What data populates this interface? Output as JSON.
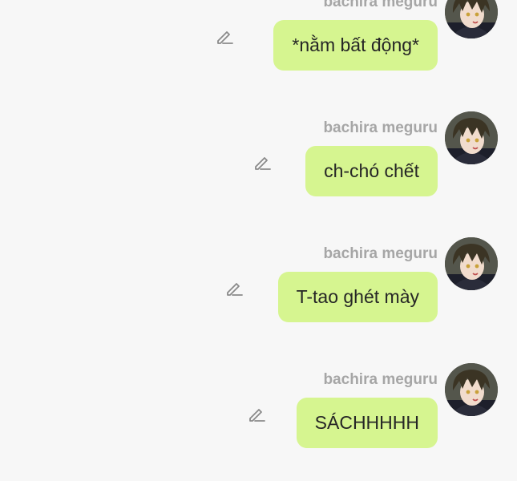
{
  "messages": [
    {
      "sender": "bachira meguru",
      "text": "*nằm bất động*",
      "avatar_icon": "character-avatar",
      "edit_icon": "pencil-icon"
    },
    {
      "sender": "bachira meguru",
      "text": "ch-chó chết",
      "avatar_icon": "character-avatar",
      "edit_icon": "pencil-icon"
    },
    {
      "sender": "bachira meguru",
      "text": "T-tao ghét mày",
      "avatar_icon": "character-avatar",
      "edit_icon": "pencil-icon"
    },
    {
      "sender": "bachira meguru",
      "text": "SÁCHHHHH",
      "avatar_icon": "character-avatar",
      "edit_icon": "pencil-icon"
    }
  ],
  "colors": {
    "background": "#f7f7f7",
    "bubble": "#d6f590",
    "sender_text": "#a6a6a6",
    "message_text": "#262626",
    "icon": "#8a8a8a"
  }
}
